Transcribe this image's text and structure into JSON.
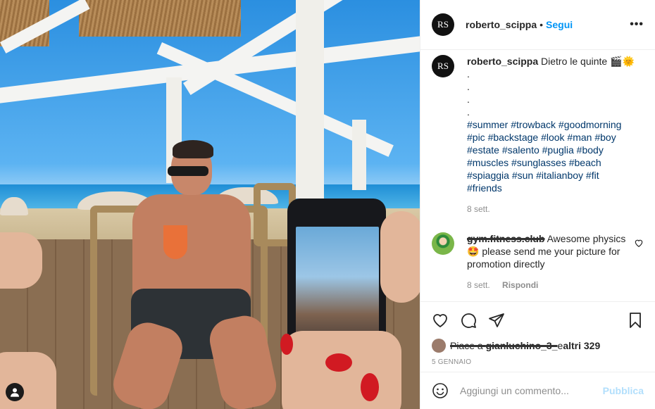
{
  "post": {
    "username": "roberto_scippa",
    "avatar_initials": "RS",
    "separator": "•",
    "follow_label": "Segui",
    "more_icon": "more-horizontal-icon",
    "photo_alt": "Man in sunglasses sitting in a beach bar chair holding a spritz while being photographed with a phone"
  },
  "caption": {
    "username": "roberto_scippa",
    "text": "Dietro le quinte 🎬🌞",
    "dots": ".\n.\n.\n.",
    "hashtags": "#summer #trowback #goodmorning #pic #backstage #look #man #boy #estate #salento #puglia #body #muscles #sunglasses #beach #spiaggia #sun #italianboy #fit #friends",
    "time": "8 sett."
  },
  "comments": [
    {
      "username": "gym.fitness.club",
      "text": "Awesome physics 🤩 please send me your picture for promotion directly",
      "time": "8 sett.",
      "reply_label": "Rispondi",
      "like_icon": "heart-outline-icon"
    }
  ],
  "actions": {
    "like_icon": "heart-outline-icon",
    "comment_icon": "comment-bubble-icon",
    "share_icon": "paper-plane-icon",
    "save_icon": "bookmark-icon"
  },
  "likes": {
    "prefix": "Piace a ",
    "liker": "gianluchino_3_",
    "suffix": " e ",
    "others": "altri 329"
  },
  "date": "5 GENNAIO",
  "composer": {
    "emoji_icon": "smiley-face-icon",
    "placeholder": "Aggiungi un commento...",
    "publish_label": "Pubblica"
  },
  "colors": {
    "link_blue": "#0095f6",
    "hashtag_blue": "#00376b",
    "disabled_blue": "#b2dffc",
    "meta_gray": "#8e8e8e",
    "text": "#262626"
  }
}
